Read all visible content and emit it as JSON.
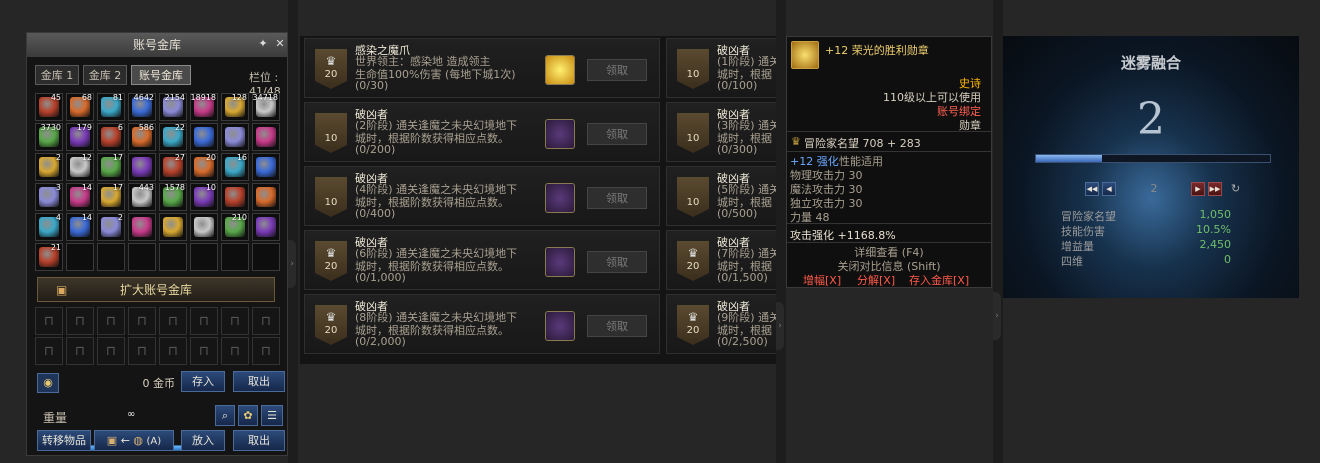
{
  "vault": {
    "title": "账号金库",
    "tabs": [
      "金库 1",
      "金库 2",
      "账号金库"
    ],
    "slot_info": "栏位 : 41/48",
    "item_counts": [
      "45",
      "68",
      "81",
      "4642",
      "2154",
      "18918",
      "128",
      "34718",
      "3730",
      "179",
      "6",
      "586",
      "22",
      "",
      "",
      "",
      "2",
      "12",
      "17",
      "",
      "27",
      "20",
      "16",
      "",
      "3",
      "14",
      "17",
      "443",
      "1578",
      "10",
      "",
      "",
      "4",
      "14",
      "2",
      "",
      "",
      "",
      "210",
      "",
      "21"
    ],
    "expand_label": "扩大账号金库",
    "gold_amount": "0 金币",
    "deposit_label": "存入",
    "withdraw_label": "取出",
    "weight_label": "重量",
    "weight_value": "∞",
    "transfer_label": "转移物品",
    "transfer_hint": "(A)",
    "put_label": "放入",
    "take_label": "取出"
  },
  "rewards": {
    "claim_label": "领取",
    "left": [
      {
        "badge": "20",
        "title": "感染之魔爪",
        "desc1": "世界领主：感染地      造成领主",
        "desc2": "生命值100%伤害 (每地下城1次)",
        "progress": "(0/30)"
      },
      {
        "badge": "10",
        "title": "破凶者",
        "desc1": "(2阶段) 通关逢魔之未央幻境地下",
        "desc2": "城时，根据阶数获得相应点数。",
        "progress": "(0/200)"
      },
      {
        "badge": "10",
        "title": "破凶者",
        "desc1": "(4阶段) 通关逢魔之未央幻境地下",
        "desc2": "城时，根据阶数获得相应点数。",
        "progress": "(0/400)"
      },
      {
        "badge": "20",
        "title": "破凶者",
        "desc1": "(6阶段) 通关逢魔之未央幻境地下",
        "desc2": "城时，根据阶数获得相应点数。",
        "progress": "(0/1,000)"
      },
      {
        "badge": "20",
        "title": "破凶者",
        "desc1": "(8阶段) 通关逢魔之未央幻境地下",
        "desc2": "城时，根据阶数获得相应点数。",
        "progress": "(0/2,000)"
      }
    ],
    "right": [
      {
        "badge": "10",
        "title": "破凶者",
        "desc1": "(1阶段) 通关",
        "desc2": "城时，根据",
        "progress": "(0/100)"
      },
      {
        "badge": "10",
        "title": "破凶者",
        "desc1": "(3阶段) 通关",
        "desc2": "城时，根据",
        "progress": "(0/300)"
      },
      {
        "badge": "10",
        "title": "破凶者",
        "desc1": "(5阶段) 通关",
        "desc2": "城时，根据",
        "progress": "(0/500)"
      },
      {
        "badge": "20",
        "title": "破凶者",
        "desc1": "(7阶段) 通关",
        "desc2": "城时，根据",
        "progress": "(0/1,500)"
      },
      {
        "badge": "20",
        "title": "破凶者",
        "desc1": "(9阶段) 通关",
        "desc2": "城时，根据",
        "progress": "(0/2,500)"
      }
    ]
  },
  "tooltip": {
    "name": "+12 荣光的胜利勋章",
    "rarity": "史诗",
    "level_req": "110级以上可以使用",
    "bind": "账号绑定",
    "slot": "勋章",
    "renown": "冒险家名望 708 + 283",
    "enhance_a": "+12 强化",
    "enhance_b": "性能适用",
    "stats": [
      "物理攻击力 30",
      "魔法攻击力 30",
      "独立攻击力 30",
      "力量 48"
    ],
    "atk_boost": "攻击强化 +1168.8%",
    "detail": "详细查看 (F4)",
    "close_compare": "关闭对比信息 (Shift)",
    "amplify": "增幅[X]",
    "disassemble": "分解[X]",
    "store": "存入金库[X]"
  },
  "fusion": {
    "title": "迷雾融合",
    "big_number": "2",
    "progress_fraction": 0.28,
    "page": "2",
    "stats": [
      {
        "label": "冒险家名望",
        "value": "1,050"
      },
      {
        "label": "技能伤害",
        "value": "10.5%"
      },
      {
        "label": "增益量",
        "value": "2,450"
      },
      {
        "label": "四维",
        "value": "0"
      }
    ]
  }
}
